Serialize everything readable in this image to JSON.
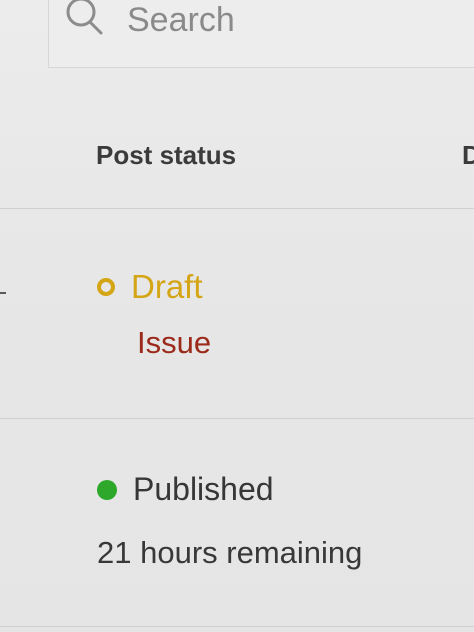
{
  "search": {
    "placeholder": "Search"
  },
  "table": {
    "columns": [
      "Post status",
      "D"
    ],
    "rows": [
      {
        "status": "Draft",
        "status_color": "#d4a514",
        "detail": "Issue",
        "detail_color": "#9b2a1a"
      },
      {
        "status": "Published",
        "status_color": "#2ea82a",
        "detail": "21 hours remaining"
      }
    ]
  },
  "icons": {
    "search": "search-icon",
    "draft": "ring-dot-icon",
    "published": "filled-dot-icon"
  }
}
